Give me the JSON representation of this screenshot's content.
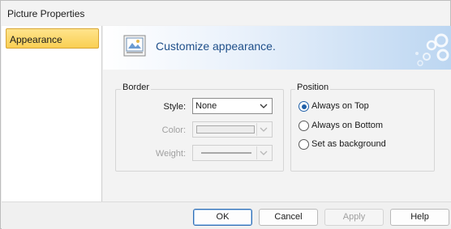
{
  "window": {
    "title": "Picture Properties"
  },
  "sidebar": {
    "items": [
      {
        "label": "Appearance",
        "selected": true
      }
    ]
  },
  "banner": {
    "text": "Customize appearance.",
    "icon": "picture-properties-icon"
  },
  "border_group": {
    "legend": "Border",
    "style": {
      "label": "Style:",
      "value": "None"
    },
    "color": {
      "label": "Color:",
      "enabled": false
    },
    "weight": {
      "label": "Weight:",
      "enabled": false
    }
  },
  "position_group": {
    "legend": "Position",
    "options": [
      {
        "label": "Always on Top",
        "checked": true
      },
      {
        "label": "Always on Bottom",
        "checked": false
      },
      {
        "label": "Set as background",
        "checked": false
      }
    ]
  },
  "buttons": {
    "ok": "OK",
    "cancel": "Cancel",
    "apply": "Apply",
    "help": "Help"
  },
  "colors": {
    "selection": "#f9cf53",
    "banner_text": "#1f4f8a",
    "radio_accent": "#1f5fa8"
  }
}
